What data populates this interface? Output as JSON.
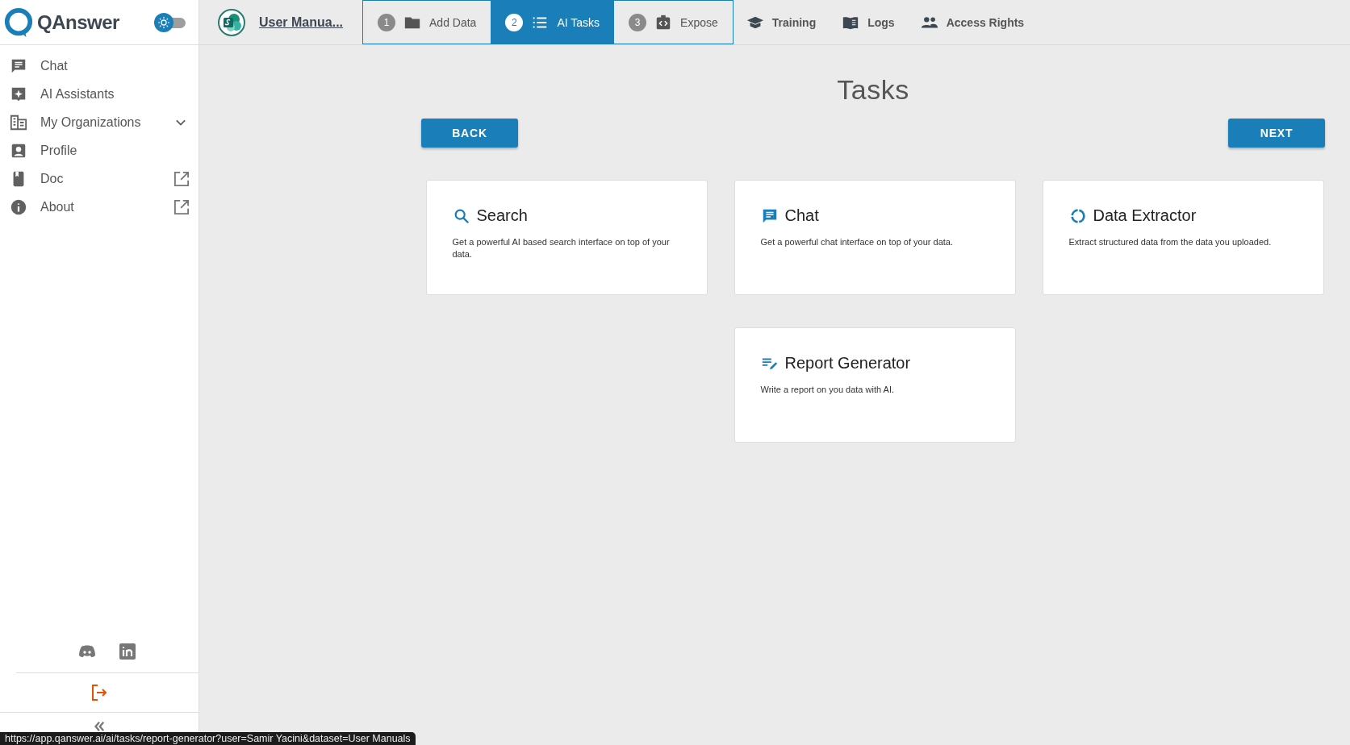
{
  "brand": {
    "name": "QAnswer"
  },
  "theme_toggle": {
    "on": false
  },
  "sidebar": {
    "items": [
      {
        "label": "Chat",
        "external": false
      },
      {
        "label": "AI Assistants",
        "external": false
      },
      {
        "label": "My Organizations",
        "expanded": false,
        "external": false
      },
      {
        "label": "Profile",
        "external": false
      },
      {
        "label": "Doc",
        "external": true
      },
      {
        "label": "About",
        "external": true
      }
    ]
  },
  "dataset": {
    "name": "User Manua..."
  },
  "steps": [
    {
      "number": "1",
      "label": "Add Data",
      "selected": false
    },
    {
      "number": "2",
      "label": "AI Tasks",
      "selected": true
    },
    {
      "number": "3",
      "label": "Expose",
      "selected": false
    }
  ],
  "nav_links": [
    {
      "label": "Training"
    },
    {
      "label": "Logs"
    },
    {
      "label": "Access Rights"
    }
  ],
  "page": {
    "title": "Tasks",
    "back_button": "BACK",
    "next_button": "NEXT"
  },
  "task_rows": [
    [
      {
        "title": "Search",
        "description": "Get a powerful AI based search interface on top of your data."
      },
      {
        "title": "Chat",
        "description": "Get a powerful chat interface on top of your data."
      },
      {
        "title": "Data Extractor",
        "description": "Extract structured data from the data you uploaded."
      }
    ],
    [
      {
        "title": "Report Generator",
        "description": "Write a report on you data with AI."
      }
    ]
  ],
  "status_url": "https://app.qanswer.ai/ai/tasks/report-generator?user=Samir Yacini&dataset=User Manuals"
}
